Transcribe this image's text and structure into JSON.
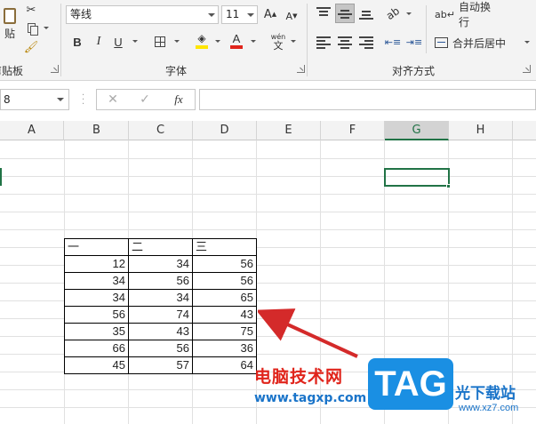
{
  "ribbon": {
    "clipboard": {
      "paste_label": "贴",
      "group_label": "剪贴板"
    },
    "font": {
      "font_name": "等线",
      "font_size": "11",
      "bold": "B",
      "italic": "I",
      "underline": "U",
      "phonetic": "wén",
      "phonetic_sub": "文",
      "group_label": "字体",
      "font_color": "#e0241b",
      "fill_color": "#ffe600"
    },
    "alignment": {
      "wrap_text": "自动换行",
      "merge_center": "合并后居中",
      "group_label": "对齐方式",
      "accent_color": "#217346"
    }
  },
  "formula_bar": {
    "name_box": "8",
    "fx_label": "fx"
  },
  "columns": [
    "A",
    "B",
    "C",
    "D",
    "E",
    "F",
    "G",
    "H"
  ],
  "selected_column": "G",
  "table": {
    "headers": [
      "一",
      "二",
      "三"
    ],
    "rows": [
      [
        "12",
        "34",
        "56"
      ],
      [
        "34",
        "56",
        "56"
      ],
      [
        "34",
        "34",
        "65"
      ],
      [
        "56",
        "74",
        "43"
      ],
      [
        "35",
        "43",
        "75"
      ],
      [
        "66",
        "56",
        "36"
      ],
      [
        "45",
        "57",
        "64"
      ]
    ]
  },
  "watermark": {
    "text": "电脑技术网",
    "url": "www.tagxp.com",
    "logo": "TAG",
    "site": "光下载站",
    "site_url": "www.xz7.com"
  }
}
